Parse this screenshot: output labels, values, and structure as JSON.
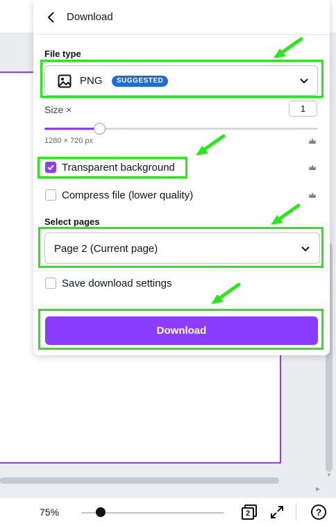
{
  "panel": {
    "title": "Download",
    "file_type": {
      "label": "File type",
      "value": "PNG",
      "badge": "SUGGESTED",
      "badge_color": "#1c6cd9"
    },
    "size": {
      "label": "Size ×",
      "value": "1",
      "dimensions": "1280 × 720 px",
      "slider_level": 0.2
    },
    "transparent_background": {
      "label": "Transparent background",
      "checked": true
    },
    "compress_file": {
      "label": "Compress file (lower quality)",
      "checked": false
    },
    "select_pages": {
      "label": "Select pages",
      "value": "Page 2 (Current page)"
    },
    "save_settings": {
      "label": "Save download settings",
      "checked": false
    },
    "download_button": "Download",
    "accent_color": "#8b3dff"
  },
  "bottom_bar": {
    "zoom": "75%",
    "page_count": "2",
    "help": "?"
  },
  "annotation_color": "#28e817"
}
